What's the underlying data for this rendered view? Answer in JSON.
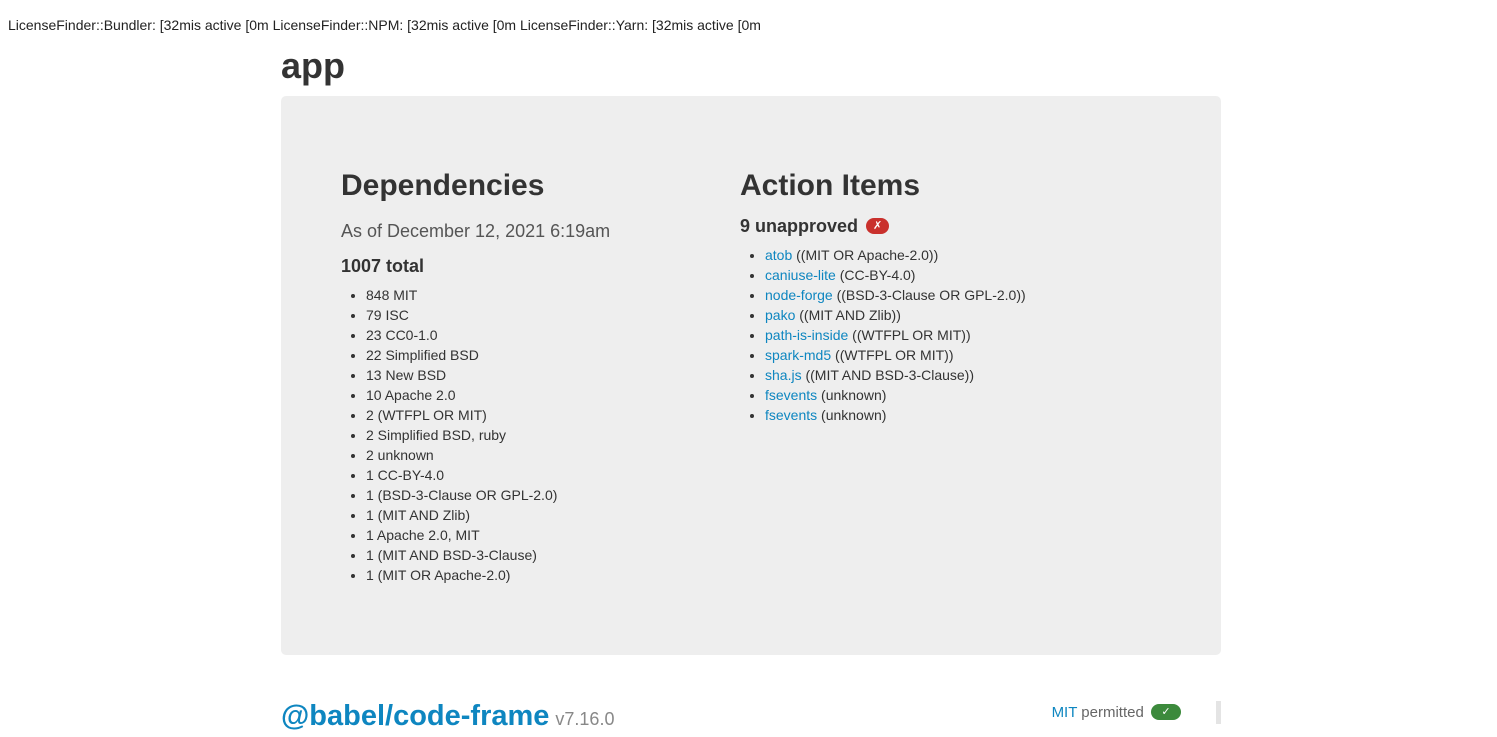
{
  "topline": "LicenseFinder::Bundler:  [32mis active [0m LicenseFinder::NPM:  [32mis active [0m LicenseFinder::Yarn:  [32mis active [0m",
  "app_title": "app",
  "dependencies": {
    "title": "Dependencies",
    "as_of": "As of December 12, 2021 6:19am",
    "total": "1007 total",
    "items": [
      "848 MIT",
      "79 ISC",
      "23 CC0-1.0",
      "22 Simplified BSD",
      "13 New BSD",
      "10 Apache 2.0",
      "2 (WTFPL OR MIT)",
      "2 Simplified BSD, ruby",
      "2 unknown",
      "1 CC-BY-4.0",
      "1 (BSD-3-Clause OR GPL-2.0)",
      "1 (MIT AND Zlib)",
      "1 Apache 2.0, MIT",
      "1 (MIT AND BSD-3-Clause)",
      "1 (MIT OR Apache-2.0)"
    ]
  },
  "action_items": {
    "title": "Action Items",
    "unapproved": "9 unapproved",
    "badge": "✗",
    "items": [
      {
        "name": "atob",
        "license": "((MIT OR Apache-2.0))"
      },
      {
        "name": "caniuse-lite",
        "license": "(CC-BY-4.0)"
      },
      {
        "name": "node-forge",
        "license": "((BSD-3-Clause OR GPL-2.0))"
      },
      {
        "name": "pako",
        "license": "((MIT AND Zlib))"
      },
      {
        "name": "path-is-inside",
        "license": "((WTFPL OR MIT))"
      },
      {
        "name": "spark-md5",
        "license": "((WTFPL OR MIT))"
      },
      {
        "name": "sha.js",
        "license": "((MIT AND BSD-3-Clause))"
      },
      {
        "name": "fsevents",
        "license": "(unknown)"
      },
      {
        "name": "fsevents",
        "license": "(unknown)"
      }
    ]
  },
  "package": {
    "name": "@babel/code-frame",
    "version": "v7.16.0",
    "license": "MIT",
    "status": "permitted",
    "badge": "✓"
  },
  "colors": {
    "link": "#0e86c0",
    "panel_bg": "#eeeeee",
    "badge_red": "#c9302c",
    "badge_green": "#3c8a3c"
  }
}
